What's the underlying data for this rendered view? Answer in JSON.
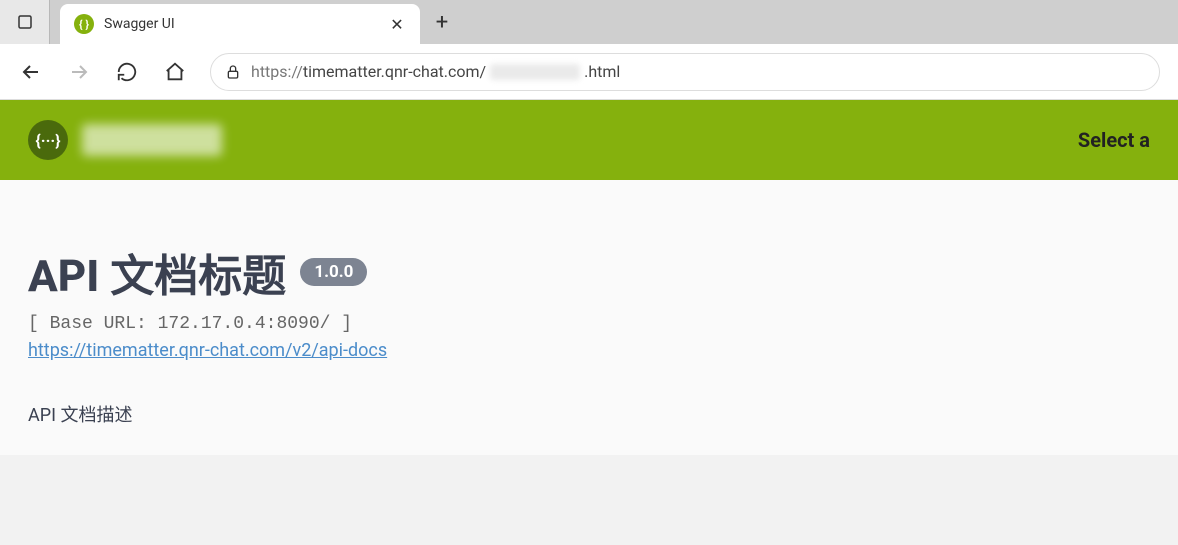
{
  "browser": {
    "tab": {
      "title": "Swagger UI",
      "close": "✕",
      "new": "+"
    },
    "address": {
      "prefix": "https://",
      "host": "timematter.qnr-chat.com/",
      "suffix": ".html"
    }
  },
  "swagger": {
    "topbar": {
      "select_label": "Select a"
    },
    "api": {
      "title": "API 文档标题",
      "version": "1.0.0",
      "base_url": "[ Base URL: 172.17.0.4:8090/ ]",
      "docs_link": "https://timematter.qnr-chat.com/v2/api-docs",
      "description": "API 文档描述"
    }
  }
}
